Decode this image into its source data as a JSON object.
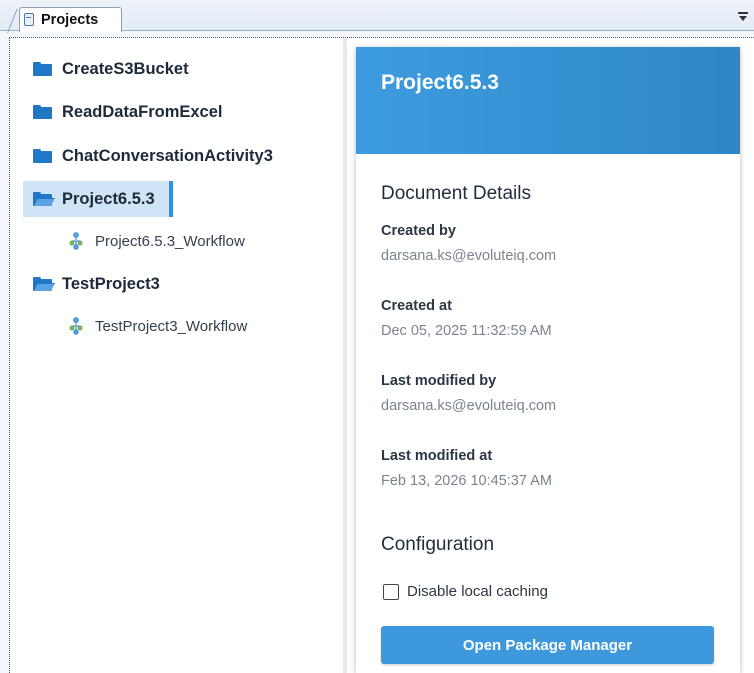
{
  "tab": {
    "label": "Projects",
    "icon": "document-icon"
  },
  "tree": {
    "items": [
      {
        "label": "CreateS3Bucket",
        "kind": "folder"
      },
      {
        "label": "ReadDataFromExcel",
        "kind": "folder"
      },
      {
        "label": "ChatConversationActivity3",
        "kind": "folder"
      },
      {
        "label": "Project6.5.3",
        "kind": "folder-open",
        "selected": true
      },
      {
        "label": "Project6.5.3_Workflow",
        "kind": "workflow"
      },
      {
        "label": "TestProject3",
        "kind": "folder-open"
      },
      {
        "label": "TestProject3_Workflow",
        "kind": "workflow"
      }
    ]
  },
  "details": {
    "title": "Project6.5.3",
    "document_section": "Document Details",
    "created_by_label": "Created by",
    "created_by_value": "darsana.ks@evoluteiq.com",
    "created_at_label": "Created at",
    "created_at_value": "Dec 05, 2025 11:32:59 AM",
    "modified_by_label": "Last modified by",
    "modified_by_value": "darsana.ks@evoluteiq.com",
    "modified_at_label": "Last modified at",
    "modified_at_value": "Feb 13, 2026 10:45:37 AM",
    "config_section": "Configuration",
    "disable_caching_label": "Disable local caching",
    "disable_caching_checked": false,
    "package_manager_button": "Open Package Manager"
  },
  "colors": {
    "accent": "#3d98dc",
    "header_gradient_start": "#3d9cdf",
    "header_gradient_end": "#2e86c8",
    "folder": "#1f77c8",
    "selection_bg": "#cfe4f7"
  }
}
